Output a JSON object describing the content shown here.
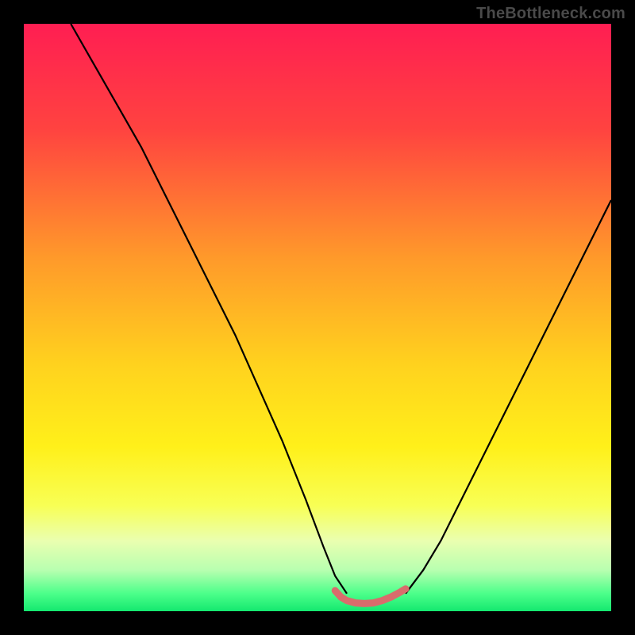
{
  "watermark": "TheBottleneck.com",
  "chart_data": {
    "type": "line",
    "title": "",
    "xlabel": "",
    "ylabel": "",
    "xlim": [
      0,
      100
    ],
    "ylim": [
      0,
      100
    ],
    "gradient_stops": [
      {
        "offset": 0,
        "color": "#ff1e52"
      },
      {
        "offset": 18,
        "color": "#ff4340"
      },
      {
        "offset": 40,
        "color": "#ff9a2a"
      },
      {
        "offset": 58,
        "color": "#ffd21e"
      },
      {
        "offset": 72,
        "color": "#fff01a"
      },
      {
        "offset": 82,
        "color": "#f8ff55"
      },
      {
        "offset": 88,
        "color": "#eaffb0"
      },
      {
        "offset": 93,
        "color": "#b8ffb0"
      },
      {
        "offset": 97,
        "color": "#4cff8a"
      },
      {
        "offset": 100,
        "color": "#14e86f"
      }
    ],
    "series": [
      {
        "name": "left-curve",
        "stroke": "#000000",
        "width": 2.2,
        "x": [
          8,
          12,
          16,
          20,
          24,
          28,
          32,
          36,
          40,
          44,
          48,
          51,
          53,
          55
        ],
        "y": [
          100,
          93,
          86,
          79,
          71,
          63,
          55,
          47,
          38,
          29,
          19,
          11,
          6,
          3
        ]
      },
      {
        "name": "right-curve",
        "stroke": "#000000",
        "width": 2.2,
        "x": [
          65,
          68,
          71,
          74,
          77,
          80,
          83,
          86,
          89,
          92,
          95,
          98,
          100
        ],
        "y": [
          3,
          7,
          12,
          18,
          24,
          30,
          36,
          42,
          48,
          54,
          60,
          66,
          70
        ]
      },
      {
        "name": "valley-highlight",
        "stroke": "#d96c6c",
        "width": 9,
        "linecap": "round",
        "x": [
          53,
          54,
          55,
          56.5,
          58,
          59.5,
          61,
          62.5,
          64,
          65
        ],
        "y": [
          3.5,
          2.4,
          1.8,
          1.4,
          1.3,
          1.4,
          1.8,
          2.4,
          3.2,
          3.8
        ]
      }
    ]
  }
}
